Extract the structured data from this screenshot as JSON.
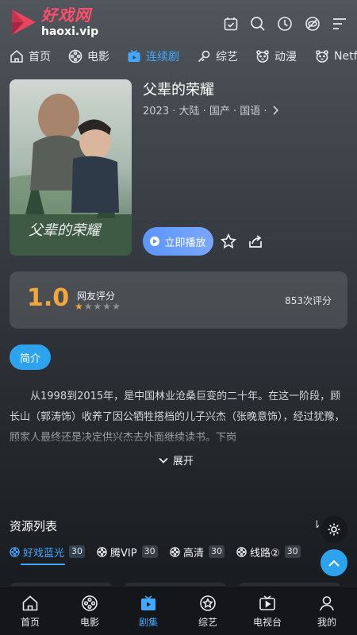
{
  "header": {
    "brand_cn": "好戏网",
    "brand_en": "haoxi.vip",
    "icons": [
      "calendar-check-icon",
      "search-icon",
      "history-icon",
      "eye-off-icon",
      "menu-icon"
    ],
    "brand_color": "#ff4d6d"
  },
  "nav": {
    "items": [
      {
        "label": "首页",
        "icon": "home-icon"
      },
      {
        "label": "电影",
        "icon": "film-reel-icon"
      },
      {
        "label": "连续剧",
        "icon": "tv-icon",
        "active": true
      },
      {
        "label": "综艺",
        "icon": "mic-icon"
      },
      {
        "label": "动漫",
        "icon": "bear-icon"
      },
      {
        "label": "Netf",
        "icon": "bear-icon"
      }
    ],
    "active_color": "#42a8ff"
  },
  "detail": {
    "title": "父辈的荣耀",
    "meta": "2023 · 大陆 · 国产 · 国语 ·",
    "play_label": "立即播放"
  },
  "rating": {
    "score": "1.0",
    "label": "网友评分",
    "count": "853次评分",
    "stars_filled": 1,
    "stars_total": 5,
    "color": "#f3a73b"
  },
  "intro": {
    "tag": "简介",
    "text": "从1998到2015年，是中国林业沧桑巨变的二十年。在这一阶段，顾长山（郭涛饰）收养了因公牺牲搭档的儿子兴杰（张晚意饰），经过犹豫，顾家人最终还是决定供兴杰去外面继续读书。下岗",
    "expand_label": "展开"
  },
  "resources": {
    "title": "资源列表",
    "sort_label": "⇂⇃",
    "tabs": [
      {
        "label": "好戏蓝光",
        "count": "30",
        "active": true
      },
      {
        "label": "腾VIP",
        "count": "30"
      },
      {
        "label": "高清",
        "count": "30"
      },
      {
        "label": "线路②",
        "count": "30"
      }
    ]
  },
  "bottom_nav": {
    "items": [
      {
        "label": "首页",
        "icon": "home-icon"
      },
      {
        "label": "电影",
        "icon": "film-reel-icon"
      },
      {
        "label": "剧集",
        "icon": "tv-icon",
        "active": true
      },
      {
        "label": "综艺",
        "icon": "star-badge-icon"
      },
      {
        "label": "电视台",
        "icon": "tv-play-icon"
      },
      {
        "label": "我的",
        "icon": "user-icon"
      }
    ]
  }
}
